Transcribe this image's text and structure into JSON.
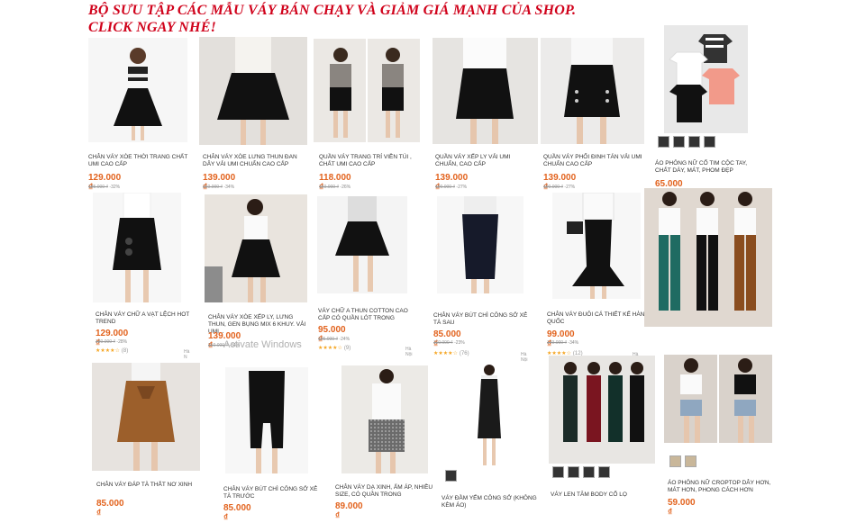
{
  "headline": "BỘ SƯU TẬP CÁC MẪU VÁY  BÁN CHẠY VÀ GIẢM GIÁ MẠNH CỦA SHOP. CLICK NGAY NHÉ!",
  "watermark": "Activate Windows",
  "colors": {
    "headline": "#d0021b",
    "price": "#e2631e",
    "stars": "#f5a623"
  },
  "products": [
    {
      "title": "CHÂN VÁY XÒE THỜI TRANG CHẤT UMI CAO CẤP",
      "price": "129.000 ₫",
      "old_price": "185.000 ₫",
      "discount": "-32%"
    },
    {
      "title": "CHÂN VÁY XÒE LƯNG THUN ĐAN DÂY VẢI UMI CHUẨN CAO CẤP",
      "price": "139.000 ₫",
      "old_price": "210.000 ₫",
      "discount": "-34%"
    },
    {
      "title": "QUẦN VÁY TRANG TRÍ VIỀN TÚI , CHẤT UMI CAO CẤP",
      "price": "118.000 ₫",
      "old_price": "160.000 ₫",
      "discount": "-26%"
    },
    {
      "title": "QUẦN VÁY XẾP LY VẢI UMI CHUẨN, CAO CẤP",
      "price": "139.000 ₫",
      "old_price": "190.000 ₫",
      "discount": "-27%"
    },
    {
      "title": "QUẦN VÁY PHỐI ĐINH TÁN VẢI UMI CHUẨN CAO CẤP",
      "price": "139.000 ₫",
      "old_price": "190.000 ₫",
      "discount": "-27%"
    },
    {
      "title": "ÁO PHÔNG NỮ CỔ TIM CỘC TAY, CHẤT DÀY, MÁT, PHOM ĐẸP",
      "price": "65.000 ₫"
    },
    {
      "title": "CHÂN VÁY CHỮ A VẠT LỆCH HOT TREND",
      "price": "129.000 ₫",
      "old_price": "180.000 ₫",
      "discount": "-28%",
      "rating": "★★★★☆",
      "rating_count": "(8)",
      "location": "Hà N"
    },
    {
      "title": "CHÂN VÁY XÒE XẾP LY, LƯNG THUN, GEN BỤNG MIX 6 KHUY. VẢI UMI...",
      "price": "139.000 ₫",
      "old_price": "210.000 ₫",
      "discount": "-34%"
    },
    {
      "title": "VÁY CHỮ A THUN COTTON CAO CẤP CÓ QUẦN LÓT TRONG",
      "price": "95.000 ₫",
      "old_price": "125.000 ₫",
      "discount": "-24%",
      "rating": "★★★★☆",
      "rating_count": "(9)",
      "location": "Hà Nội"
    },
    {
      "title": "CHÂN VÁY BÚT CHÌ CÔNG SỞ XẺ TÀ SAU",
      "price": "85.000 ₫",
      "old_price": "110.000 ₫",
      "discount": "-23%",
      "rating": "★★★★☆",
      "rating_count": "(76)",
      "location": "Hà Nội"
    },
    {
      "title": "CHÂN VÁY ĐUÔI CÁ THIẾT KẾ HÀN QUỐC",
      "price": "99.000 ₫",
      "old_price": "149.000 ₫",
      "discount": "-34%",
      "rating": "★★★★☆",
      "rating_count": "(12)",
      "location": "Hà Nội"
    },
    {
      "title": "",
      "price": ""
    },
    {
      "title": "CHÂN VÁY ĐÁP TÀ THẮT NƠ XINH",
      "price": "85.000 ₫"
    },
    {
      "title": "CHÂN VÁY BÚT CHÌ CÔNG SỞ XẺ TÀ TRƯỚC",
      "price": "85.000 ₫"
    },
    {
      "title": "CHÂN VÁY DẠ XINH, ẤM ÁP, NHIỀU SIZE, CÓ QUẦN TRONG",
      "price": "89.000 ₫"
    },
    {
      "title": "VÁY ĐẦM YẾM CÔNG SỞ (KHÔNG KÈM ÁO)",
      "price": ""
    },
    {
      "title": "VÁY LEN TĂM BODY CỔ LỌ",
      "price": ""
    },
    {
      "title": "ÁO PHÔNG NỮ CROPTOP DÂY HƠN, MÁT HƠN, PHONG CÁCH HƠN",
      "price": "59.000 ₫"
    }
  ]
}
